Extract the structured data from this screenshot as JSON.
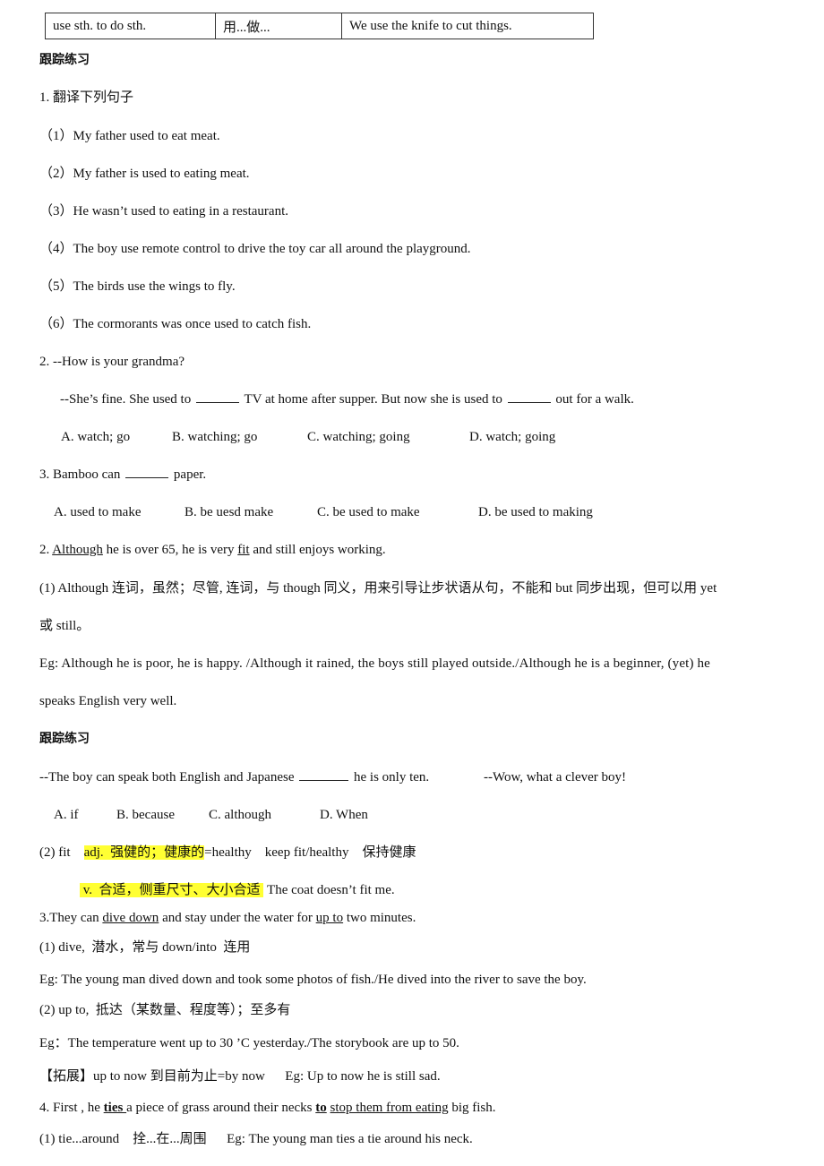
{
  "table_row": {
    "phrase": "use sth. to do sth.",
    "meaning": "用...做...",
    "example": "We use the knife to cut things."
  },
  "practice1": {
    "heading": "跟踪练习",
    "q1_title": "1. 翻译下列句子",
    "q1_items": [
      "（1）My father used to eat meat.",
      "（2）My father is used to eating meat.",
      "（3）He wasn’t used to eating in a restaurant.",
      "（4）The boy use remote control to drive the toy car all around the playground.",
      "（5）The birds use the wings to fly.",
      "（6）The cormorants was once used to catch fish."
    ],
    "q2_line1": "2. --How is your grandma?",
    "q2_line2_a": "--She’s fine. She used to ",
    "q2_line2_b": " TV at home after supper. But now she is used to ",
    "q2_line2_c": " out for a walk.",
    "q2_options": [
      "A. watch; go",
      "B. watching; go",
      "C. watching; going",
      "D. watch; going"
    ],
    "q3_a": "3. Bamboo can ",
    "q3_b": " paper.",
    "q3_options": [
      "A. used to make",
      "B. be uesd make",
      "C. be used to make",
      "D. be used to making"
    ]
  },
  "point2": {
    "num": "2. ",
    "w_although": "Although",
    "mid": " he is over 65, he is very ",
    "w_fit": "fit",
    "end": " and still enjoys working.",
    "note1_line1": "(1) Although 连词，虽然；尽管, 连词，与 though 同义，用来引导让步状语从句，不能和 but 同步出现，但可以用 yet",
    "note1_line2": "或 still。",
    "eg_line1": "Eg: Although he is poor, he is happy. /Although it rained, the boys still played outside./Although he is a beginner, (yet) he",
    "eg_line2": "speaks English very well."
  },
  "practice2": {
    "heading": "跟踪练习",
    "q_a": "--The boy can speak both English and Japanese ",
    "q_b": " he is only ten.",
    "q_reply": "--Wow, what a clever boy!",
    "options": [
      "A. if",
      "B. because",
      "C. although",
      "D. When"
    ]
  },
  "fit_note": {
    "label": "(2) fit",
    "adj_hl": "adj.  强健的；健康的",
    "adj_rest": "=healthy    keep fit/healthy    保持健康",
    "v_hl": " v.  合适，侧重尺寸、大小合适 ",
    "v_rest": " The coat doesn’t fit me."
  },
  "point3": {
    "a": "3.They can ",
    "u1": "dive down",
    "b": " and stay under the water for ",
    "u2": "up to",
    "c": " two minutes.",
    "note1": "(1) dive,  潜水，常与 down/into  连用",
    "eg1": "Eg: The young man dived down and took some photos of fish./He dived into the river to save the boy.",
    "note2": "(2) up to,  抵达（某数量、程度等）；至多有",
    "eg2": "Eg：The temperature went up to 30 ’C yesterday./The storybook are up to 50.",
    "ext": "【拓展】up to now 到目前为止=by now      Eg: Up to now he is still sad."
  },
  "point4": {
    "a": "4. First , he ",
    "b_ties": "ties ",
    "c": "a piece of grass around their necks ",
    "d_to": "to",
    "e": " ",
    "f_u": "stop them from eating",
    "g": " big fish.",
    "note1": "(1) tie...around    拴...在...周围      Eg: The young man ties a tie around his neck."
  },
  "colors": {
    "highlight": "#ffff33",
    "text": "#111111"
  }
}
